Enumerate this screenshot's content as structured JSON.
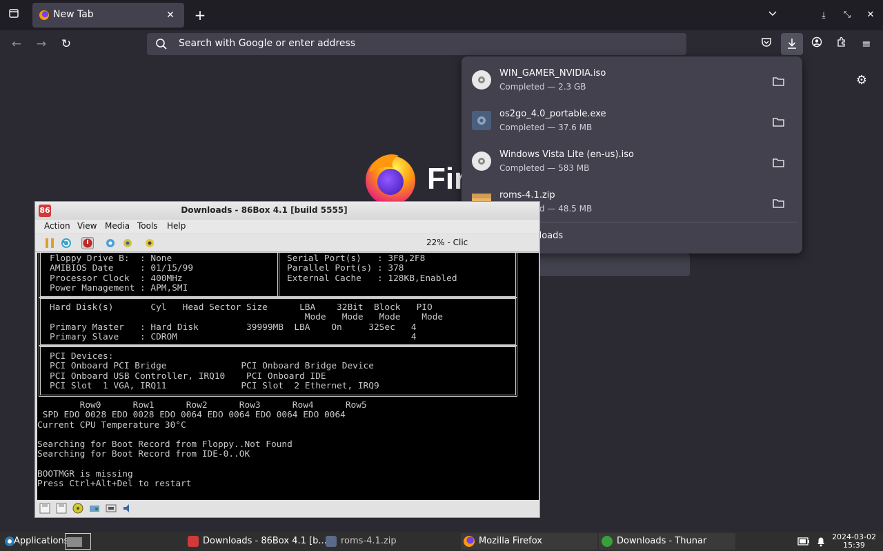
{
  "browser": {
    "tab": {
      "title": "New Tab"
    },
    "url_placeholder": "Search with Google or enter address",
    "brand_word": "Firefox"
  },
  "downloads_panel": {
    "items": [
      {
        "name": "WIN_GAMER_NVIDIA.iso",
        "status": "Completed — 2.3 GB",
        "icon": "disc-icon"
      },
      {
        "name": "os2go_4.0_portable.exe",
        "status": "Completed — 37.6 MB",
        "icon": "exe-icon"
      },
      {
        "name": "Windows Vista Lite (en-us).iso",
        "status": "Completed — 583 MB",
        "icon": "disc-icon"
      },
      {
        "name": "roms-4.1.zip",
        "status": "Completed — 48.5 MB",
        "icon": "archive-icon"
      }
    ],
    "show_all": "Show all downloads"
  },
  "box86": {
    "title": "Downloads - 86Box 4.1 [build 5555]",
    "menu": [
      "Action",
      "View",
      "Media",
      "Tools",
      "Help"
    ],
    "status_text": "22% - Clic",
    "bios": {
      "top_left": "Floppy Drive B:  : None\nAMIBIOS Date     : 01/15/99\nProcessor Clock  : 400MHz\nPower Management : APM,SMI",
      "top_right": "Serial Port(s)   : 3F8,2F8\nParallel Port(s) : 378\nExternal Cache   : 128KB,Enabled",
      "disks": "Hard Disk(s)       Cyl   Head Sector Size      LBA    32Bit  Block   PIO\n                                                Mode   Mode   Mode    Mode\nPrimary Master   : Hard Disk         39999MB  LBA    On     32Sec   4\nPrimary Slave    : CDROM                                            4",
      "pci": "PCI Devices:\nPCI Onboard PCI Bridge              PCI Onboard Bridge Device\nPCI Onboard USB Controller, IRQ10    PCI Onboard IDE\nPCI Slot  1 VGA, IRQ11              PCI Slot  2 Ethernet, IRQ9",
      "bottom": "        Row0      Row1      Row2      Row3      Row4      Row5\n SPD EDO 0028 EDO 0028 EDO 0064 EDO 0064 EDO 0064 EDO 0064\nCurrent CPU Temperature 30°C\n\nSearching for Boot Record from Floppy..Not Found\nSearching for Boot Record from IDE-0..OK\n\nBOOTMGR is missing\nPress Ctrl+Alt+Del to restart"
    }
  },
  "taskbar": {
    "applications": "Applications",
    "tasks": [
      {
        "label": "Downloads - 86Box 4.1 [b...",
        "icon": "86box-icon"
      },
      {
        "label": "roms-4.1.zip",
        "icon": "archive-icon"
      },
      {
        "label": "Mozilla Firefox",
        "icon": "firefox-icon"
      },
      {
        "label": "Downloads - Thunar",
        "icon": "download-icon"
      }
    ],
    "clock": {
      "date": "2024-03-02",
      "time": "15:39"
    }
  }
}
